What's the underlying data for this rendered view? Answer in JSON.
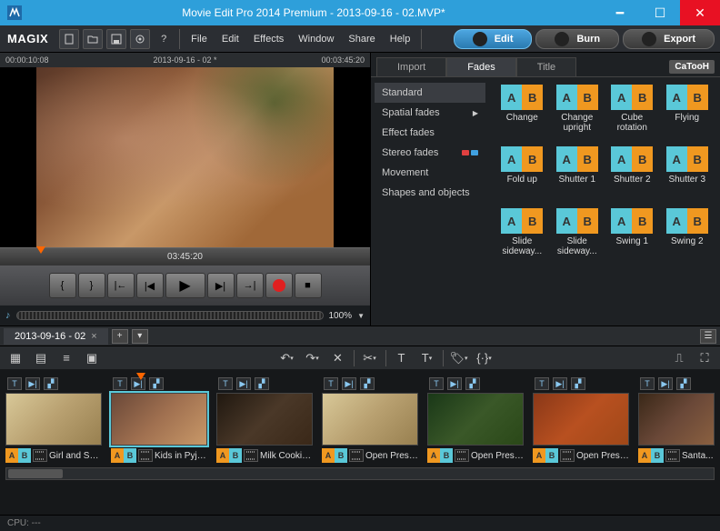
{
  "window": {
    "title": "Movie Edit Pro 2014 Premium - 2013-09-16 - 02.MVP*"
  },
  "brand": "MAGIX",
  "menu": [
    "File",
    "Edit",
    "Effects",
    "Window",
    "Share",
    "Help"
  ],
  "modes": {
    "edit": "Edit",
    "burn": "Burn",
    "export": "Export"
  },
  "preview": {
    "time_left": "00:00:10:08",
    "title": "2013-09-16 - 02 *",
    "time_right": "00:03:45:20",
    "ruler_time": "03:45:20",
    "zoom": "100%"
  },
  "pool": {
    "tabs": {
      "import": "Import",
      "fades": "Fades",
      "title": "Title"
    },
    "brand": "CaTooH",
    "categories": [
      {
        "name": "Standard",
        "sel": true
      },
      {
        "name": "Spatial fades",
        "arrow": true
      },
      {
        "name": "Effect fades"
      },
      {
        "name": "Stereo fades",
        "stereo": true
      },
      {
        "name": "Movement"
      },
      {
        "name": "Shapes and objects"
      }
    ],
    "effects": [
      "Change",
      "Change upright",
      "Cube rotation",
      "Flying",
      "Fold up",
      "Shutter 1",
      "Shutter 2",
      "Shutter 3",
      "Slide sideway...",
      "Slide sideway...",
      "Swing 1",
      "Swing 2"
    ]
  },
  "project_tab": "2013-09-16 - 02",
  "clips": [
    {
      "name": "Girl and Sant...",
      "v": "v4"
    },
    {
      "name": "Kids in Pyjam...",
      "v": "",
      "selected": true
    },
    {
      "name": "Milk Cookies...",
      "v": "v3"
    },
    {
      "name": "Open Presents...",
      "v": "v4"
    },
    {
      "name": "Open Presents...",
      "v": "v5"
    },
    {
      "name": "Open Presents...",
      "v": "v6"
    },
    {
      "name": "Santa...",
      "v": "v2"
    }
  ],
  "status": {
    "cpu": "CPU: ---"
  }
}
